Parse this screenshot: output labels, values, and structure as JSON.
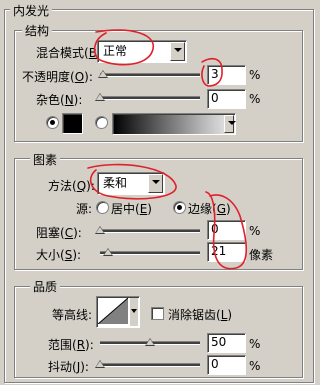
{
  "title": "内发光",
  "structure": {
    "legend": "结构",
    "blend_mode": {
      "label": "混合模式(",
      "key": "B",
      "suffix": "):",
      "value": "正常"
    },
    "opacity": {
      "label": "不透明度(",
      "key": "O",
      "suffix": "):",
      "value": "3",
      "unit": "%",
      "slider": 0.03
    },
    "noise": {
      "label": "杂色(",
      "key": "N",
      "suffix": "):",
      "value": "0",
      "unit": "%",
      "slider": 0.0
    },
    "fill": {
      "color_selected": true,
      "gradient_selected": false,
      "swatch_color": "#000000"
    }
  },
  "elements": {
    "legend": "图素",
    "method": {
      "label": "方法(",
      "key": "Q",
      "suffix": "):",
      "value": "柔和"
    },
    "source": {
      "label": "源:",
      "center": {
        "label": "居中(",
        "key": "E",
        "suffix": ")",
        "selected": false
      },
      "edge": {
        "label": "边缘(",
        "key": "G",
        "suffix": ")",
        "selected": true
      }
    },
    "choke": {
      "label": "阻塞(",
      "key": "C",
      "suffix": "):",
      "value": "0",
      "unit": "%",
      "slider": 0.0
    },
    "size": {
      "label": "大小(",
      "key": "S",
      "suffix": "):",
      "value": "21",
      "unit": "像素",
      "slider": 0.08
    }
  },
  "quality": {
    "legend": "品质",
    "contour": {
      "label": "等高线:",
      "anti_alias": {
        "label": "消除锯齿(",
        "key": "L",
        "suffix": ")",
        "checked": false
      }
    },
    "range": {
      "label": "范围(",
      "key": "R",
      "suffix": "):",
      "value": "50",
      "unit": "%",
      "slider": 0.5
    },
    "jitter": {
      "label": "抖动(",
      "key": "J",
      "suffix": "):",
      "value": "0",
      "unit": "%",
      "slider": 0.0
    }
  },
  "colors": {
    "annotation": "#e0202a",
    "panel": "#d4d0c8"
  }
}
